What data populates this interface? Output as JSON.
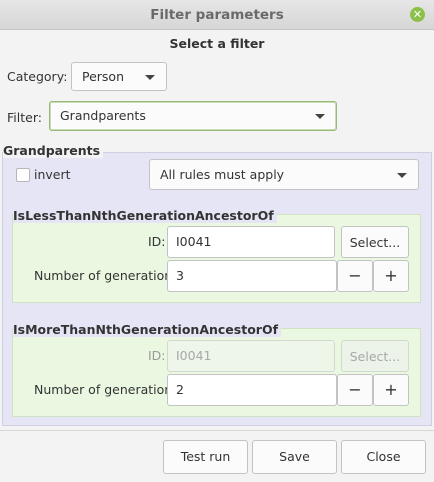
{
  "window": {
    "title": "Filter parameters",
    "close_icon": "close-icon"
  },
  "dialog": {
    "heading": "Select a filter",
    "category_label": "Category:",
    "category_value": "Person",
    "filter_label": "Filter:",
    "filter_value": "Grandparents"
  },
  "group": {
    "title": "Grandparents",
    "invert_label": "invert",
    "invert_checked": false,
    "rules_mode": "All rules must apply"
  },
  "rules": [
    {
      "name": "IsLessThanNthGenerationAncestorOf",
      "id_label": "ID:",
      "id_value": "I0041",
      "select_label": "Select...",
      "generations_label": "Number of generations:",
      "generations_value": "3",
      "minus": "−",
      "plus": "+",
      "enabled": true
    },
    {
      "name": "IsMoreThanNthGenerationAncestorOf",
      "id_label": "ID:",
      "id_value": "I0041",
      "select_label": "Select...",
      "generations_label": "Number of generations:",
      "generations_value": "2",
      "minus": "−",
      "plus": "+",
      "enabled": false
    }
  ],
  "buttons": {
    "test_run": "Test run",
    "save": "Save",
    "close": "Close"
  },
  "colors": {
    "accent_green": "#8cc04b",
    "panel_lavender": "#e6e5f6",
    "frame_green": "#eaf8e2"
  }
}
